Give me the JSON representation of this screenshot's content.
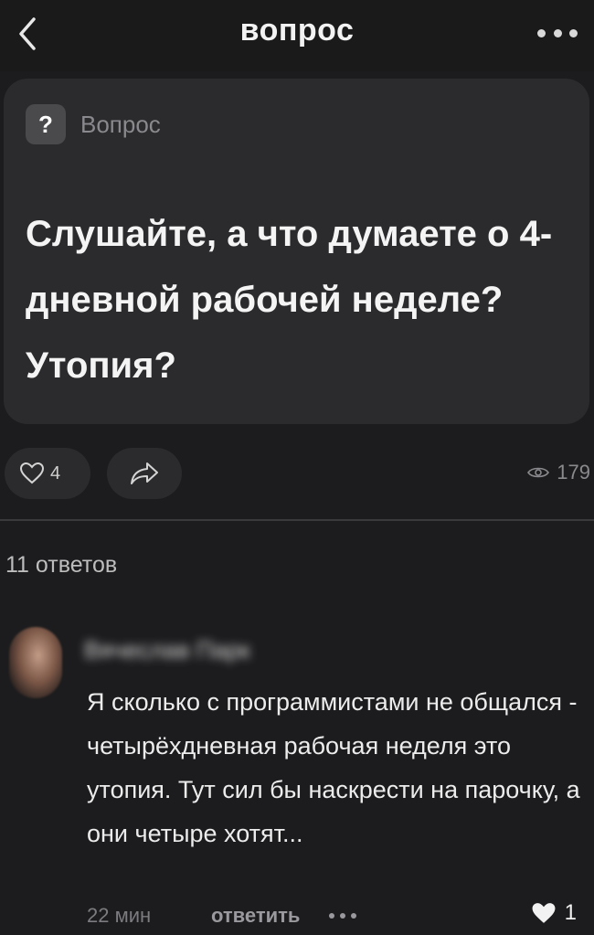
{
  "header": {
    "title": "вопрос",
    "back_icon": "chevron-left-icon",
    "more_icon": "more-horizontal-icon"
  },
  "question": {
    "badge_icon": "?",
    "badge_label": "Вопрос",
    "text": "Слушайте, а что думаете о 4-дневной рабочей неделе? Утопия?"
  },
  "actions": {
    "like_icon": "heart-outline-icon",
    "likes": "4",
    "share_icon": "share-icon",
    "views_icon": "eye-icon",
    "views": "179"
  },
  "answers": {
    "count_label": "11 ответов"
  },
  "comment": {
    "author": "Вячеслав Парк",
    "text": "Я сколько с программистами не общался - четырёхдневная рабочая неделя это утопия. Тут сил бы наскрести на парочку, а они четыре хотят...",
    "time": "22 мин",
    "reply_label": "ответить",
    "like_icon": "heart-filled-icon",
    "likes": "1"
  },
  "colors": {
    "background": "#1c1c1e",
    "card": "#2b2b2d",
    "text_primary": "#f4f4f4",
    "text_secondary": "#8a8a8e"
  }
}
